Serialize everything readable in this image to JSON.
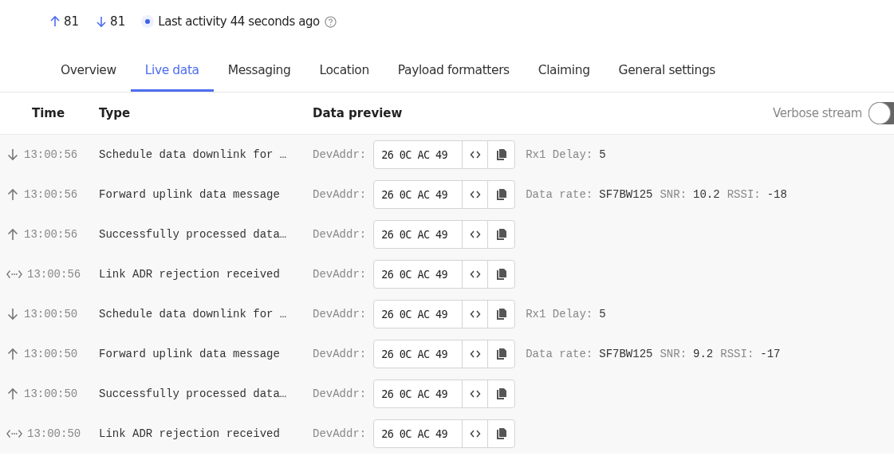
{
  "stats": {
    "uplink": "81",
    "downlink": "81",
    "activity": "Last activity 44 seconds ago"
  },
  "tabs": [
    {
      "label": "Overview",
      "selected": false
    },
    {
      "label": "Live data",
      "selected": true
    },
    {
      "label": "Messaging",
      "selected": false
    },
    {
      "label": "Location",
      "selected": false
    },
    {
      "label": "Payload formatters",
      "selected": false
    },
    {
      "label": "Claiming",
      "selected": false
    },
    {
      "label": "General settings",
      "selected": false
    }
  ],
  "table": {
    "columns": [
      "Time",
      "Type",
      "Data preview"
    ],
    "verbose_stream": {
      "label": "Verbose stream",
      "on": false
    },
    "rows": [
      {
        "kind": "down",
        "time": "13:00:56",
        "type": "Schedule data downlink for …",
        "addr_label": "DevAddr:",
        "addr": "26 0C AC 49",
        "details": [
          {
            "label": "Rx1 Delay:",
            "value": "5"
          }
        ]
      },
      {
        "kind": "up",
        "time": "13:00:56",
        "type": "Forward uplink data message",
        "addr_label": "DevAddr:",
        "addr": "26 0C AC 49",
        "details": [
          {
            "label": "Data rate:",
            "value": "SF7BW125"
          },
          {
            "label": "SNR:",
            "value": "10.2"
          },
          {
            "label": "RSSI:",
            "value": "-18"
          }
        ]
      },
      {
        "kind": "up",
        "time": "13:00:56",
        "type": "Successfully processed data…",
        "addr_label": "DevAddr:",
        "addr": "26 0C AC 49",
        "details": []
      },
      {
        "kind": "both",
        "time": "13:00:56",
        "type": "Link ADR rejection received",
        "addr_label": "DevAddr:",
        "addr": "26 0C AC 49",
        "details": []
      },
      {
        "kind": "down",
        "time": "13:00:50",
        "type": "Schedule data downlink for …",
        "addr_label": "DevAddr:",
        "addr": "26 0C AC 49",
        "details": [
          {
            "label": "Rx1 Delay:",
            "value": "5"
          }
        ]
      },
      {
        "kind": "up",
        "time": "13:00:50",
        "type": "Forward uplink data message",
        "addr_label": "DevAddr:",
        "addr": "26 0C AC 49",
        "details": [
          {
            "label": "Data rate:",
            "value": "SF7BW125"
          },
          {
            "label": "SNR:",
            "value": "9.2"
          },
          {
            "label": "RSSI:",
            "value": "-17"
          }
        ]
      },
      {
        "kind": "up",
        "time": "13:00:50",
        "type": "Successfully processed data…",
        "addr_label": "DevAddr:",
        "addr": "26 0C AC 49",
        "details": []
      },
      {
        "kind": "both",
        "time": "13:00:50",
        "type": "Link ADR rejection received",
        "addr_label": "DevAddr:",
        "addr": "26 0C AC 49",
        "details": []
      }
    ]
  }
}
